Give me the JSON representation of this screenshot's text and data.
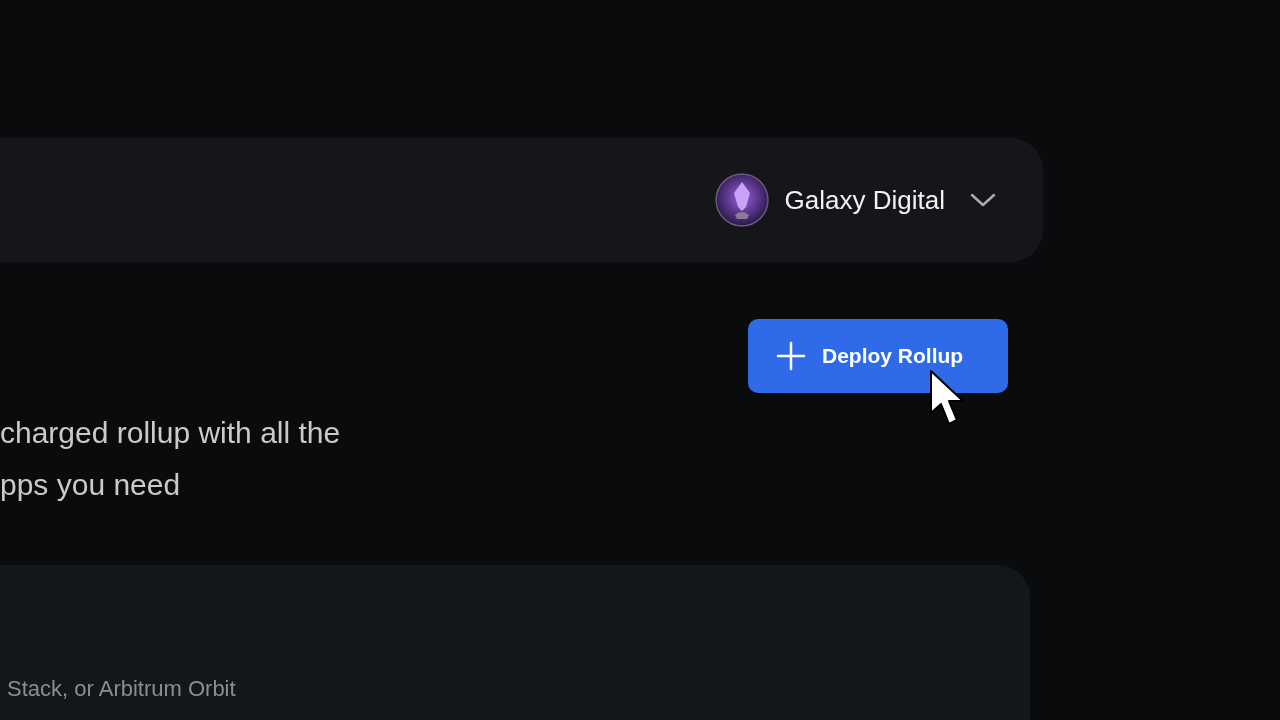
{
  "header": {
    "account": {
      "name": "Galaxy Digital",
      "expanded": false
    }
  },
  "deploy_button": {
    "label": "Deploy Rollup"
  },
  "description": "charged rollup with all the\npps you need",
  "card": {
    "text": "Stack, or Arbitrum Orbit"
  }
}
